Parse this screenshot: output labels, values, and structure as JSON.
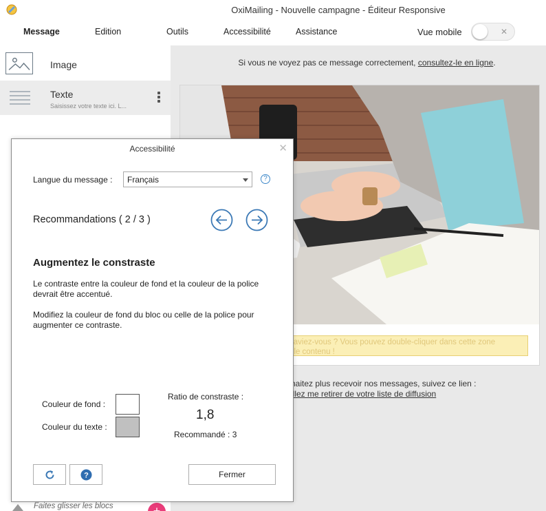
{
  "window": {
    "title": "OxiMailing - Nouvelle campagne - Éditeur Responsive"
  },
  "ribbon": {
    "tabs": [
      {
        "label": "Message",
        "active": true
      },
      {
        "label": "Edition",
        "active": false
      },
      {
        "label": "Outils",
        "active": false
      },
      {
        "label": "Accessibilité",
        "active": false
      },
      {
        "label": "Assistance",
        "active": false
      }
    ],
    "mobile_toggle": {
      "label": "Vue mobile",
      "state": "off",
      "off_glyph": "✕"
    }
  },
  "blocks_panel": {
    "items": [
      {
        "label": "Image",
        "icon": "image-icon"
      },
      {
        "label": "Texte",
        "subtitle": "Saisissez votre texte ici. L...",
        "icon": "text-lines-icon"
      }
    ],
    "drag_hint": "Faites glisser les blocs",
    "add_button": "+"
  },
  "email": {
    "preheader_text": "Si vous ne voyez pas ce message correctement, ",
    "preheader_link": "consultez-le en ligne",
    "preheader_end": ".",
    "tip_line1": "saviez-vous ? Vous pouvez double-cliquer dans cette zone",
    "tip_line2": "t le contenu !",
    "footer_line1": "haitez plus recevoir nos messages, suivez ce lien :",
    "footer_link": "illez me retirer de votre liste de diffusion"
  },
  "dialog": {
    "title": "Accessibilité",
    "close_glyph": "✕",
    "language_label": "Langue du message :",
    "language_value": "Français",
    "help_glyph": "?",
    "recommendations_label": "Recommandations ( 2 / 3 )",
    "issue_title": "Augmentez le constraste",
    "paragraph1": "Le contraste entre la couleur de fond et la couleur de la police devrait être accentué.",
    "paragraph2": "Modifiez la couleur de fond du bloc ou celle de la police pour augmenter ce contraste.",
    "background_label": "Couleur de fond :",
    "text_color_label": "Couleur du texte :",
    "ratio_label": "Ratio de constraste :",
    "ratio_value": "1,8",
    "recommended_label": "Recommandé : 3",
    "buttons": {
      "close": "Fermer"
    },
    "colors": {
      "background_swatch": "#ffffff",
      "text_swatch": "#c0c0c0",
      "accent": "#3a78b5"
    }
  }
}
